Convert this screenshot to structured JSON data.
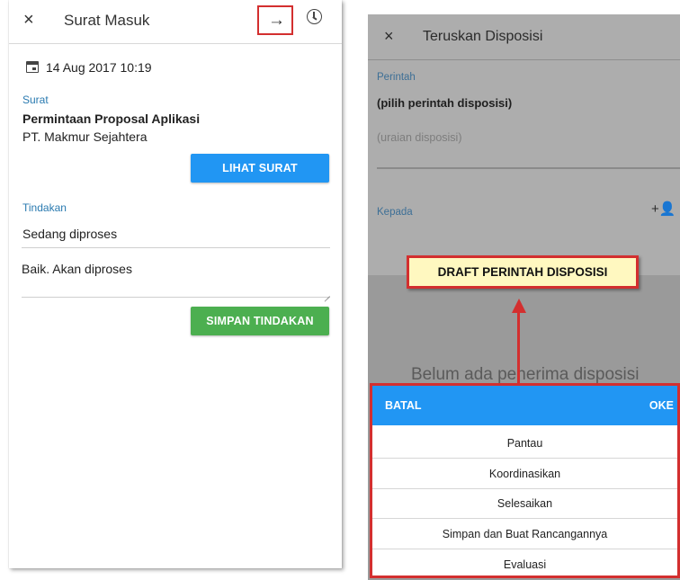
{
  "left_screen": {
    "title": "Surat Masuk",
    "close_icon": "×",
    "next_icon": "→",
    "history_icon": "clock-icon",
    "date": "14 Aug 2017 10:19",
    "surat_label": "Surat",
    "surat_subject": "Permintaan Proposal Aplikasi",
    "surat_sender": "PT. Makmur Sejahtera",
    "view_button": "LIHAT SURAT",
    "tindakan_label": "Tindakan",
    "status_value": "Sedang diproses",
    "note_value": "Baik. Akan diproses",
    "save_button": "SIMPAN TINDAKAN"
  },
  "right_screen": {
    "title": "Teruskan Disposisi",
    "close_icon": "×",
    "perintah_label": "Perintah",
    "perintah_value": "(pilih perintah disposisi)",
    "uraian_placeholder": "(uraian disposisi)",
    "kepada_label": "Kepada",
    "add_recipient_icon": "+👤",
    "empty_text": "Belum ada penerima disposisi",
    "callout": "DRAFT PERINTAH DISPOSISI",
    "picker": {
      "cancel": "BATAL",
      "ok": "OKE",
      "options": [
        "Pantau",
        "Koordinasikan",
        "Selesaikan",
        "Simpan dan Buat Rancangannya",
        "Evaluasi"
      ]
    }
  },
  "colors": {
    "primary_blue": "#2196f3",
    "action_green": "#4caf50",
    "highlight_red": "#d32f2f",
    "callout_yellow": "#fff8c0"
  }
}
